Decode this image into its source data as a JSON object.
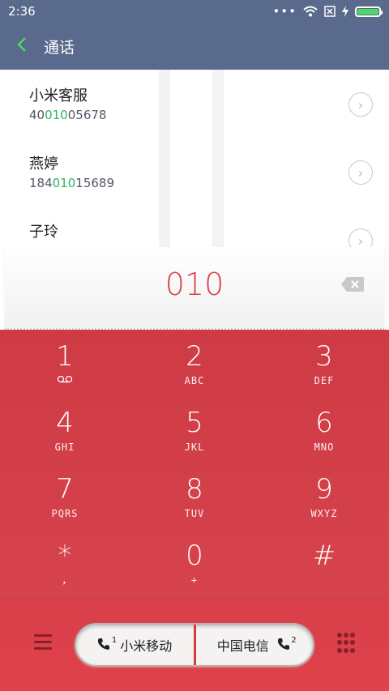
{
  "status": {
    "time": "2:36"
  },
  "header": {
    "title": "通话"
  },
  "contacts": [
    {
      "name": "小米客服",
      "num_pre": "40",
      "num_hl": "010",
      "num_post": "05678"
    },
    {
      "name": "燕婷",
      "num_pre": "184",
      "num_hl": "010",
      "num_post": "15689"
    },
    {
      "name": "子玲",
      "num_pre": "",
      "num_hl": "",
      "num_post": ""
    }
  ],
  "dialer": {
    "number": "010"
  },
  "keys": [
    {
      "digit": "1",
      "sub": ""
    },
    {
      "digit": "2",
      "sub": "ABC"
    },
    {
      "digit": "3",
      "sub": "DEF"
    },
    {
      "digit": "4",
      "sub": "GHI"
    },
    {
      "digit": "5",
      "sub": "JKL"
    },
    {
      "digit": "6",
      "sub": "MNO"
    },
    {
      "digit": "7",
      "sub": "PQRS"
    },
    {
      "digit": "8",
      "sub": "TUV"
    },
    {
      "digit": "9",
      "sub": "WXYZ"
    },
    {
      "digit": "*",
      "sub": ","
    },
    {
      "digit": "0",
      "sub": "+"
    },
    {
      "digit": "#",
      "sub": ""
    }
  ],
  "call": {
    "sim1_label": "小米移动",
    "sim1_no": "1",
    "sim2_label": "中国电信",
    "sim2_no": "2"
  },
  "colors": {
    "accent": "#d94048",
    "highlight": "#2db35f",
    "header_bg": "#5a6a8c"
  }
}
